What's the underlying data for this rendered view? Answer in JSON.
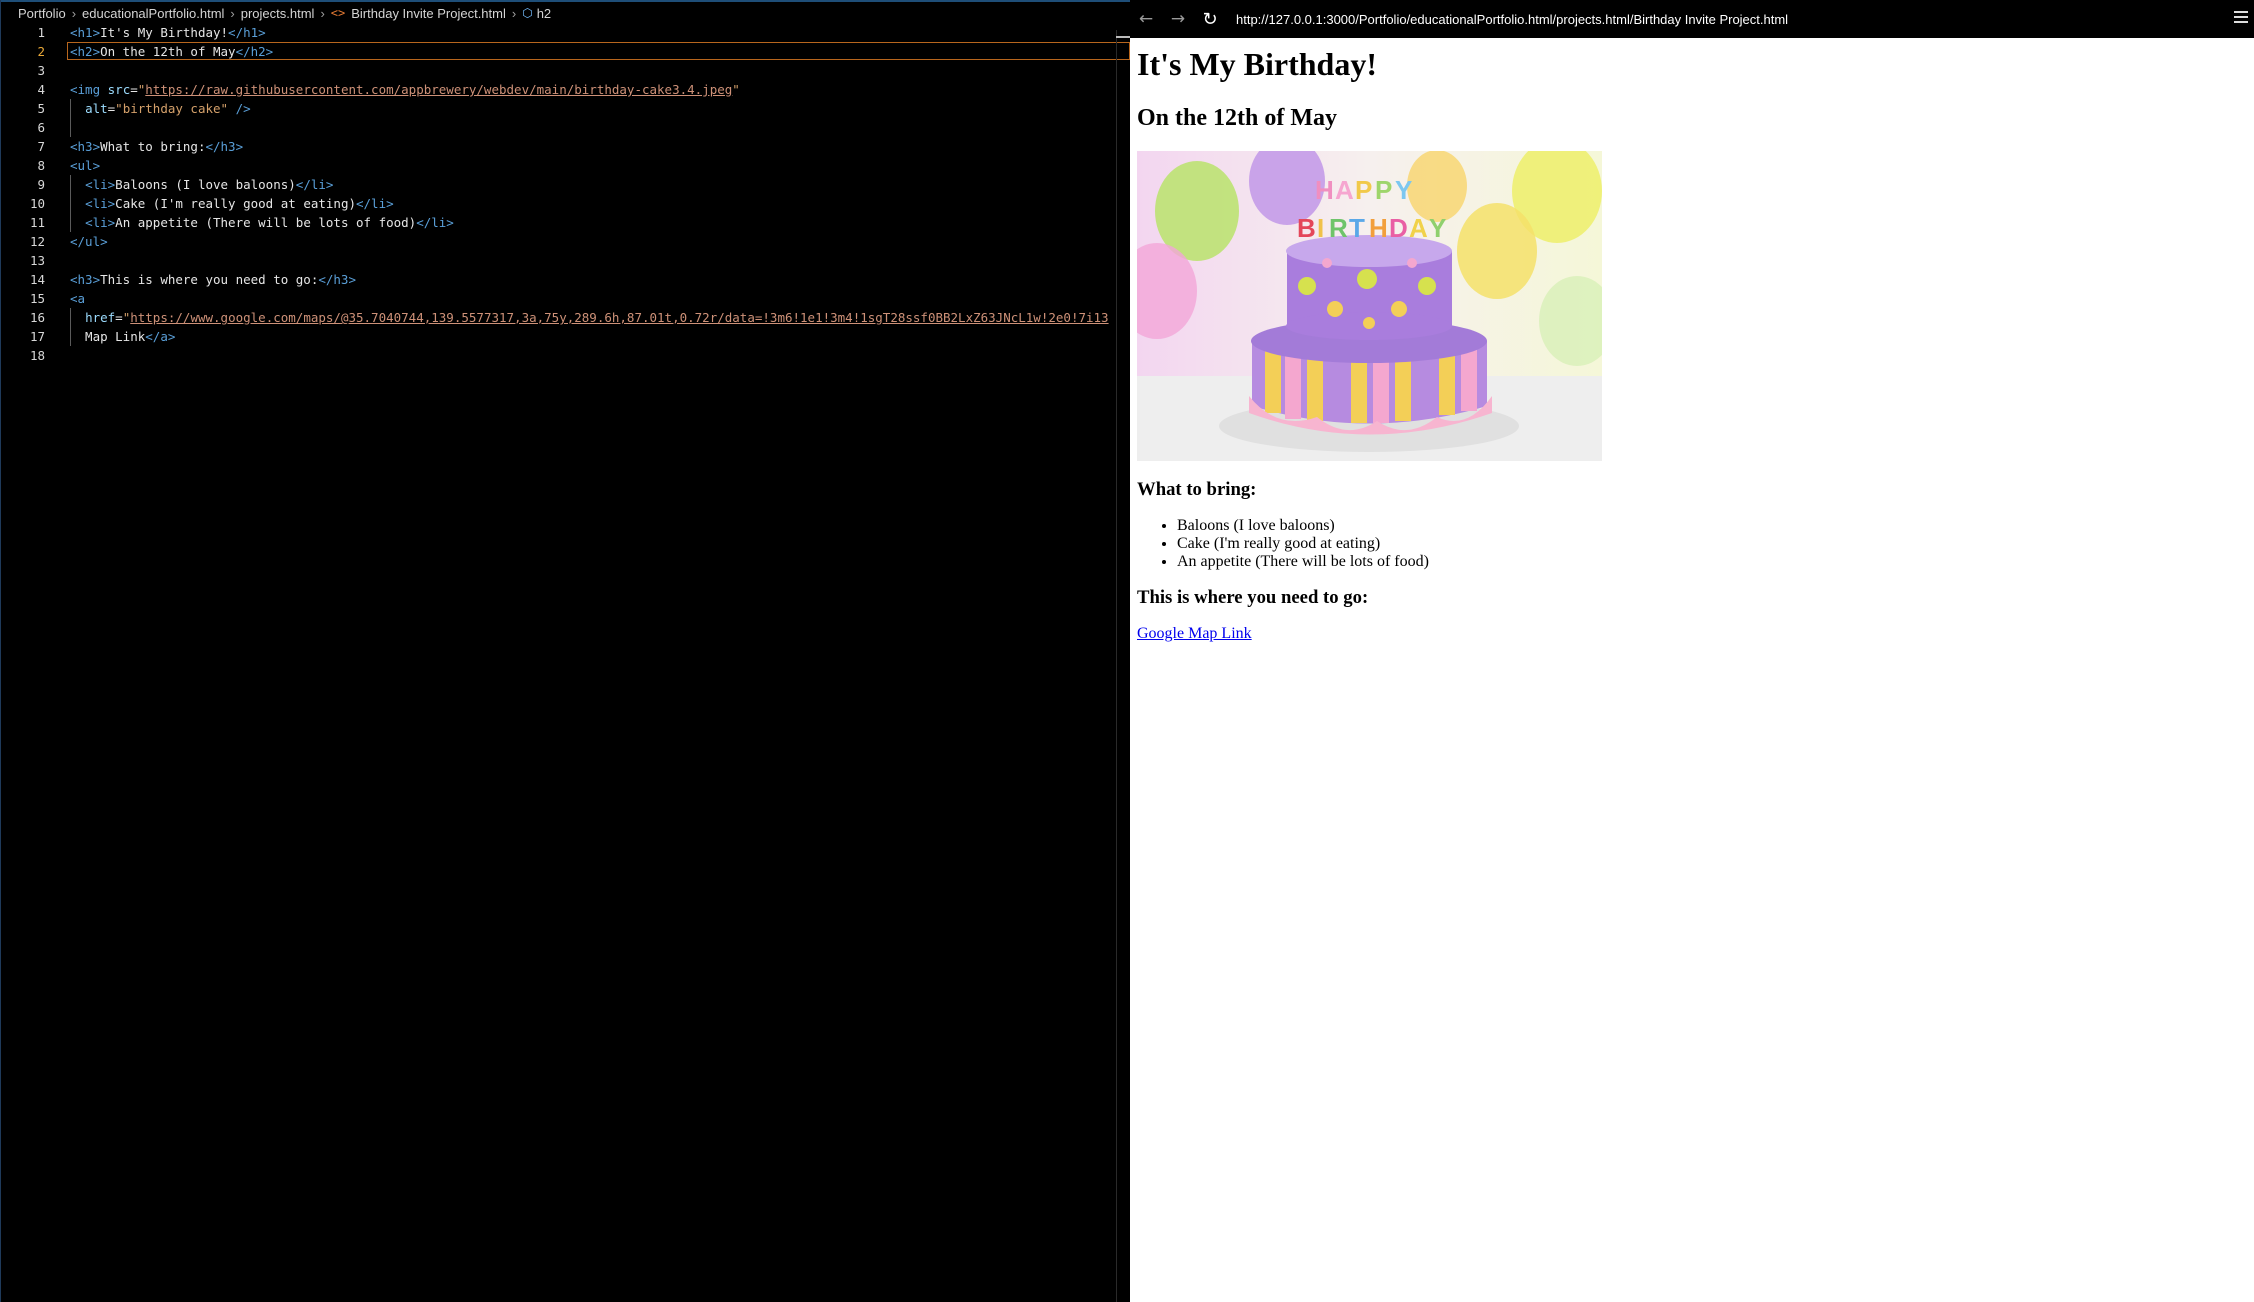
{
  "editor": {
    "breadcrumb": [
      "Portfolio",
      "educationalPortfolio.html",
      "projects.html",
      "Birthday Invite Project.html",
      "h2"
    ],
    "lines": [
      {
        "n": "1",
        "html": "<span class=\"tag\">&lt;h1&gt;</span>It's My Birthday!<span class=\"tag\">&lt;/h1&gt;</span>"
      },
      {
        "n": "2",
        "html": "<span class=\"tag\">&lt;h2&gt;</span>On the 12th of May<span class=\"tag\">&lt;/h2&gt;</span>"
      },
      {
        "n": "3",
        "html": ""
      },
      {
        "n": "4",
        "html": "<span class=\"tag\">&lt;img</span> <span class=\"attr\">src</span>=<span class=\"str\">\"</span><span class=\"url\">https://raw.githubusercontent.com/appbrewery/webdev/main/birthday-cake3.4.jpeg</span><span class=\"str\">\"</span>"
      },
      {
        "n": "5",
        "html": "  <span class=\"attr\">alt</span>=<span class=\"str\">\"birthday cake\"</span> <span class=\"tag\">/&gt;</span>"
      },
      {
        "n": "6",
        "html": ""
      },
      {
        "n": "7",
        "html": "<span class=\"tag\">&lt;h3&gt;</span>What to bring:<span class=\"tag\">&lt;/h3&gt;</span>"
      },
      {
        "n": "8",
        "html": "<span class=\"tag\">&lt;ul&gt;</span>"
      },
      {
        "n": "9",
        "html": "  <span class=\"tag\">&lt;li&gt;</span>Baloons (I love baloons)<span class=\"tag\">&lt;/li&gt;</span>"
      },
      {
        "n": "10",
        "html": "  <span class=\"tag\">&lt;li&gt;</span>Cake (I'm really good at eating)<span class=\"tag\">&lt;/li&gt;</span>"
      },
      {
        "n": "11",
        "html": "  <span class=\"tag\">&lt;li&gt;</span>An appetite (There will be lots of food)<span class=\"tag\">&lt;/li&gt;</span>"
      },
      {
        "n": "12",
        "html": "<span class=\"tag\">&lt;/ul&gt;</span>"
      },
      {
        "n": "13",
        "html": ""
      },
      {
        "n": "14",
        "html": "<span class=\"tag\">&lt;h3&gt;</span>This is where you need to go:<span class=\"tag\">&lt;/h3&gt;</span>"
      },
      {
        "n": "15",
        "html": "<span class=\"tag\">&lt;a</span>"
      },
      {
        "n": "16",
        "html": "  <span class=\"attr\">href</span>=<span class=\"str\">\"</span><span class=\"url\">https://www.google.com/maps/@35.7040744,139.5577317,3a,75y,289.6h,87.01t,0.72r/data=!3m6!1e1!3m4!1sgT28ssf0BB2LxZ63JNcL1w!2e0!7i13</span>"
      },
      {
        "n": "17",
        "html": "  Map Link<span class=\"tag\">&lt;/a&gt;</span>"
      },
      {
        "n": "18",
        "html": ""
      }
    ]
  },
  "browser": {
    "url": "http://127.0.0.1:3000/Portfolio/educationalPortfolio.html/projects.html/Birthday Invite Project.html",
    "page": {
      "h1": "It's My Birthday!",
      "h2": "On the 12th of May",
      "cake_alt": "birthday cake",
      "h3_bring": "What to bring:",
      "items": [
        "Baloons (I love baloons)",
        "Cake (I'm really good at eating)",
        "An appetite (There will be lots of food)"
      ],
      "h3_go": "This is where you need to go:",
      "link": "Google Map Link"
    }
  }
}
